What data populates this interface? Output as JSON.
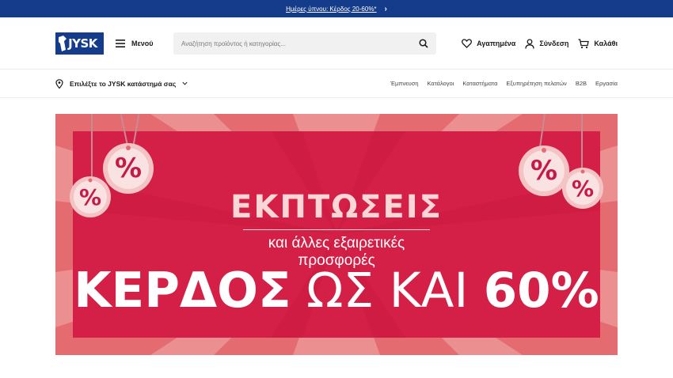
{
  "promo": {
    "text": "Ημέρες ύπνου: Κέρδος 20-60%*"
  },
  "header": {
    "logo_text": "JYSK",
    "menu_label": "Μενού",
    "search_placeholder": "Αναζήτηση προϊόντος ή κατηγορίας...",
    "favorites_label": "Αγαπημένα",
    "login_label": "Σύνδεση",
    "cart_label": "Καλάθι"
  },
  "subnav": {
    "store_label": "Επιλέξτε το JYSK κατάστημά σας",
    "links": [
      "Έμπνευση",
      "Κατάλογοι",
      "Καταστήματα",
      "Εξυπηρέτηση πελατών",
      "B2B",
      "Εργασία"
    ]
  },
  "banner": {
    "headline": "ΕΚΠΤΩΣΕΙΣ",
    "subline_1": "και άλλες εξαιρετικές",
    "subline_2": "προσφορές",
    "big_bold_1": "ΚΕΡΔΟΣ",
    "big_thin": "ΩΣ ΚΑΙ",
    "big_bold_2": "60%",
    "tag_symbol": "%"
  },
  "colors": {
    "brand": "#143c8a",
    "banner_red": "#d42047",
    "banner_ray": "#e46c70",
    "tag_text": "#c41a45"
  }
}
